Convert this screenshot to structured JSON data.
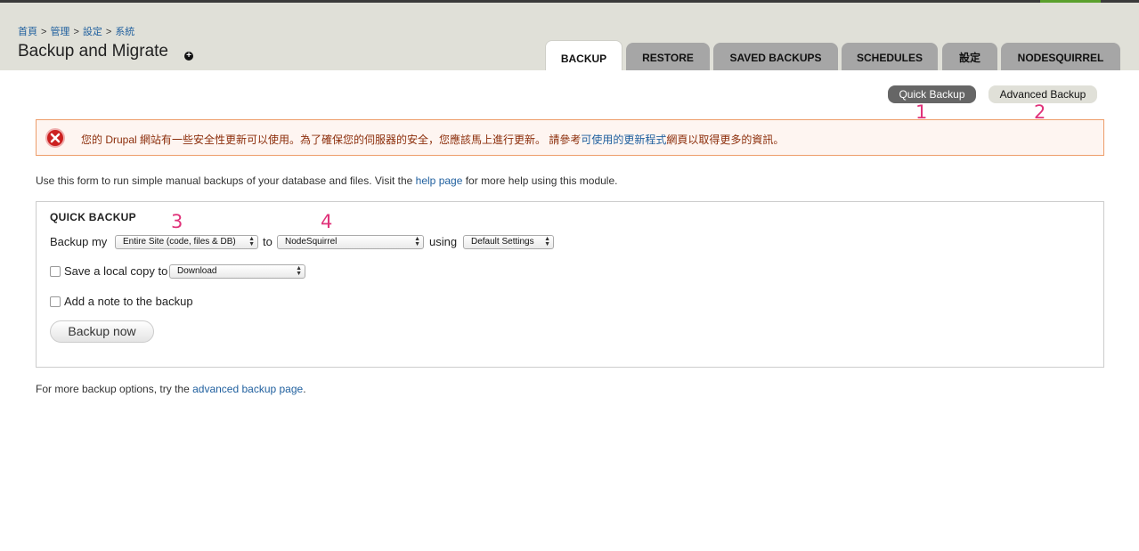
{
  "breadcrumb": [
    "首頁",
    "管理",
    "設定",
    "系統"
  ],
  "breadcrumb_sep": ">",
  "page_title": "Backup and Migrate",
  "tabs": [
    {
      "label": "BACKUP",
      "active": true
    },
    {
      "label": "RESTORE",
      "active": false
    },
    {
      "label": "SAVED BACKUPS",
      "active": false
    },
    {
      "label": "SCHEDULES",
      "active": false
    },
    {
      "label": "設定",
      "active": false
    },
    {
      "label": "NODESQUIRREL",
      "active": false
    }
  ],
  "secondary_tabs": [
    {
      "label": "Quick Backup",
      "active": true
    },
    {
      "label": "Advanced Backup",
      "active": false
    }
  ],
  "annotations": [
    "1",
    "2",
    "3",
    "4"
  ],
  "error": {
    "text_before": "您的 Drupal 網站有一些安全性更新可以使用。為了確保您的伺服器的安全，您應該馬上進行更新。 請參考",
    "link": "可使用的更新程式",
    "text_after": "網頁以取得更多的資訊。"
  },
  "intro": {
    "before": "Use this form to run simple manual backups of your database and files. Visit the ",
    "link": "help page",
    "after": " for more help using this module."
  },
  "quick_backup": {
    "legend": "QUICK BACKUP",
    "backup_my_label": "Backup my",
    "source_value": "Entire Site (code, files & DB)",
    "to_label": "to",
    "destination_value": "NodeSquirrel",
    "using_label": "using",
    "profile_value": "Default Settings",
    "local_copy_label": "Save a local copy to",
    "local_copy_value": "Download",
    "note_label": "Add a note to the backup",
    "button_label": "Backup now"
  },
  "footer": {
    "before": "For more backup options, try the ",
    "link": "advanced backup page",
    "after": "."
  },
  "colors": {
    "error_text": "#8c2e0b",
    "error_border": "#ed9d6a",
    "link": "#1f5f9e",
    "annotation": "#e0337a"
  }
}
